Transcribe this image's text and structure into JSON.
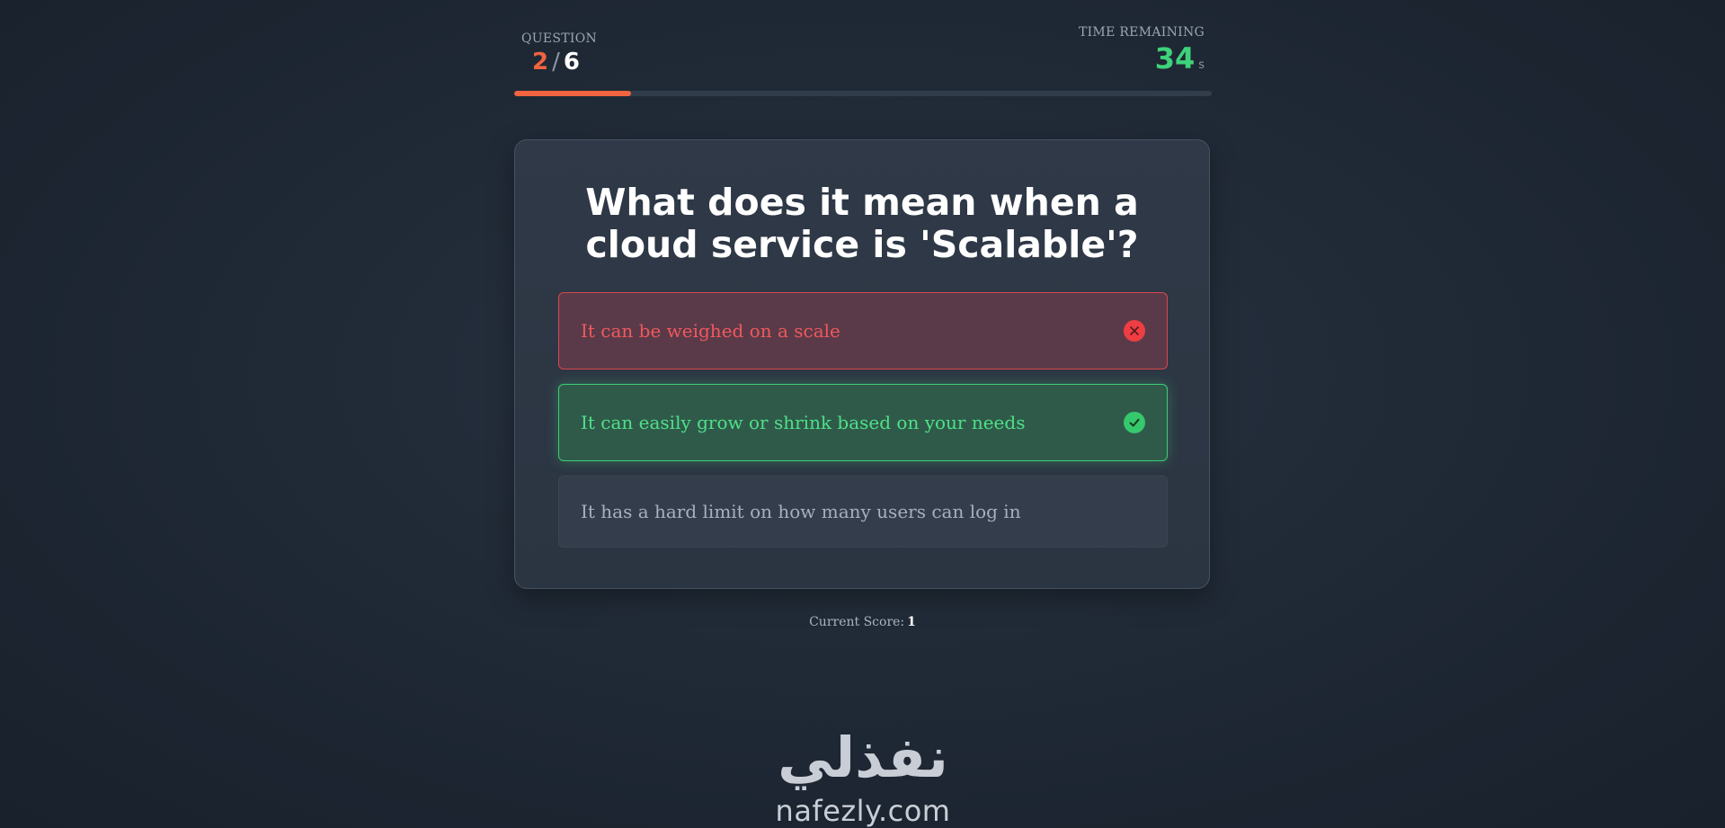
{
  "header": {
    "question_label": "QUESTION",
    "question_current": "2",
    "question_separator": "/",
    "question_total": "6",
    "time_label": "TIME REMAINING",
    "time_value": "34",
    "time_unit": "s",
    "progress_fraction": 0.167,
    "progress_color": "#f0643f"
  },
  "question": {
    "text": "What does it mean when a cloud service is 'Scalable'?"
  },
  "options": [
    {
      "label": "It can be weighed on a scale",
      "state": "wrong",
      "icon": "x-circle-icon"
    },
    {
      "label": "It can easily grow or shrink based on your needs",
      "state": "correct",
      "icon": "check-circle-icon"
    },
    {
      "label": "It has a hard limit on how many users can log in",
      "state": "neutral"
    }
  ],
  "score": {
    "label": "Current Score:",
    "value": "1"
  },
  "logo": {
    "arabic": "نفذلي",
    "latin": "nafezly.com"
  },
  "colors": {
    "accent_orange": "#f0643f",
    "timer_green": "#3ed27a",
    "wrong_red": "#ee3e44",
    "correct_green": "#36c86c"
  }
}
